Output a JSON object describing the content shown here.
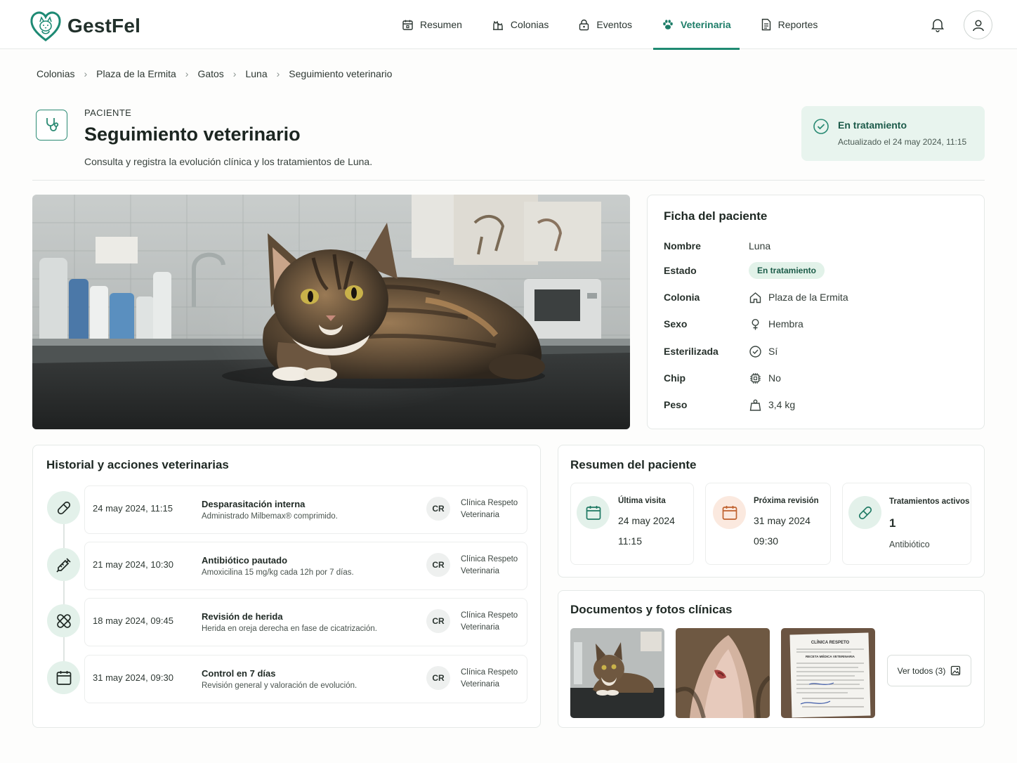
{
  "app": {
    "name": "GestFel"
  },
  "nav": {
    "items": [
      {
        "label": "Resumen",
        "icon": "calendar-icon"
      },
      {
        "label": "Colonias",
        "icon": "cats-icon"
      },
      {
        "label": "Eventos",
        "icon": "lock-icon"
      },
      {
        "label": "Veterinaria",
        "icon": "paw-icon",
        "active": true
      },
      {
        "label": "Reportes",
        "icon": "document-icon"
      }
    ]
  },
  "breadcrumb": [
    "Colonias",
    "Plaza de la Ermita",
    "Gatos",
    "Luna",
    "Seguimiento veterinario"
  ],
  "page": {
    "eyebrow": "PACIENTE",
    "title": "Seguimiento veterinario",
    "subtitle": "Consulta y registra la evolución clínica y los tratamientos de Luna."
  },
  "status": {
    "title": "En tratamiento",
    "updated": "Actualizado el 24 may 2024, 11:15"
  },
  "ficha": {
    "title": "Ficha del paciente",
    "rows": [
      {
        "label": "Nombre",
        "value": "Luna"
      },
      {
        "label": "Estado",
        "value": "En tratamiento"
      },
      {
        "label": "Colonia",
        "value": "Plaza de la Ermita"
      },
      {
        "label": "Sexo",
        "value": "Hembra"
      },
      {
        "label": "Esterilizada",
        "value": "Sí"
      },
      {
        "label": "Chip",
        "value": "No"
      },
      {
        "label": "Peso",
        "value": "3,4 kg"
      }
    ]
  },
  "historial": {
    "title": "Historial y acciones veterinarias",
    "items": [
      {
        "date": "24 may 2024, 11:15",
        "title": "Desparasitación interna",
        "desc": "Administrado Milbemax® comprimido.",
        "initials": "CR",
        "clinic": "Clínica Respeto Veterinaria",
        "icon": "pill-icon"
      },
      {
        "date": "21 may 2024, 10:30",
        "title": "Antibiótico pautado",
        "desc": "Amoxicilina 15 mg/kg cada 12h por 7 días.",
        "initials": "CR",
        "clinic": "Clínica Respeto Veterinaria",
        "icon": "syringe-icon"
      },
      {
        "date": "18 may 2024, 09:45",
        "title": "Revisión de herida",
        "desc": "Herida en oreja derecha en fase de cicatrización.",
        "initials": "CR",
        "clinic": "Clínica Respeto Veterinaria",
        "icon": "bandage-icon"
      },
      {
        "date": "31 may 2024, 09:30",
        "title": "Control en 7 días",
        "desc": "Revisión general y valoración de evolución.",
        "initials": "CR",
        "clinic": "Clínica Respeto Veterinaria",
        "icon": "calendar-icon"
      }
    ]
  },
  "resumen": {
    "title": "Resumen del paciente",
    "stats": [
      {
        "label": "Última visita",
        "v1": "24 may 2024",
        "v2": "11:15",
        "icon": "calendar-icon"
      },
      {
        "label": "Próxima revisión",
        "v1": "31 may 2024",
        "v2": "09:30",
        "icon": "calendar-icon"
      },
      {
        "label": "Tratamientos activos",
        "v1": "1",
        "v2": "Antibiótico",
        "icon": "pill-icon"
      }
    ]
  },
  "docs": {
    "title": "Documentos y fotos clínicas",
    "see_all": "Ver todos (3)",
    "doc_lines": [
      "CLÍNICA RESPETO",
      "RECETA MÉDICA VETERINARIA"
    ]
  },
  "colors": {
    "accent": "#1f8a72",
    "accent_soft": "#e3f1ea",
    "status_bg": "#e8f4ee"
  }
}
